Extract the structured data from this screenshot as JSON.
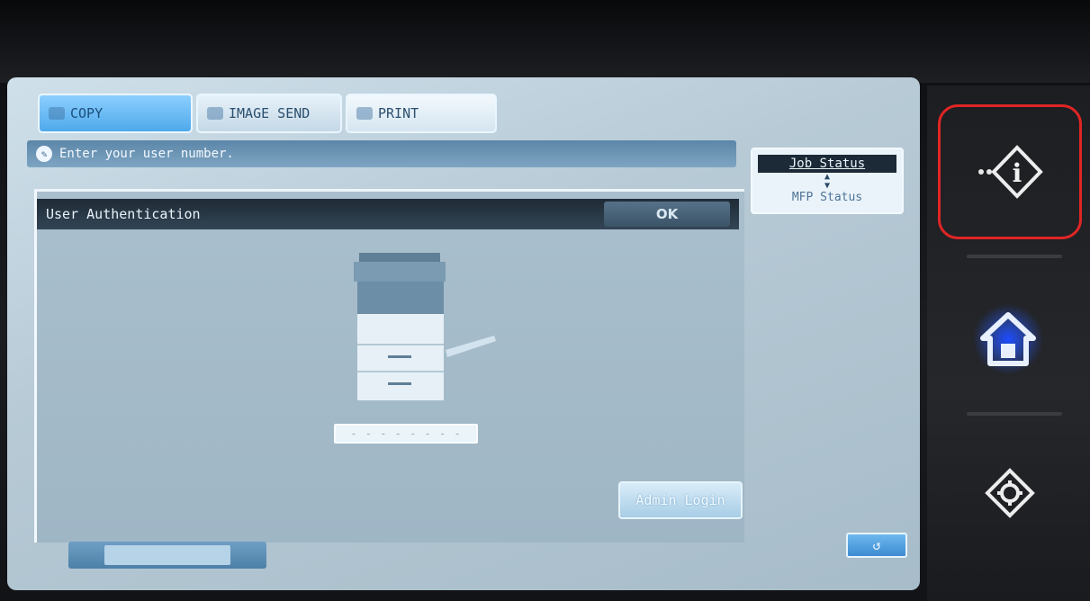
{
  "tabs": {
    "copy": "COPY",
    "image_send": "IMAGE SEND",
    "print": "PRINT"
  },
  "message": "Enter your user number.",
  "auth": {
    "title": "User Authentication",
    "ok": "OK",
    "user_number_placeholder": "- - - - - - - -",
    "admin_login": "Admin Login"
  },
  "status_panel": {
    "job_status": "Job Status",
    "toggle_arrows": "▲\n▼",
    "mfp_status": "MFP Status"
  },
  "hardware": {
    "info_icon": "info-icon",
    "home_icon": "home-icon",
    "settings_icon": "settings-icon",
    "highlight_color": "#e02525",
    "home_glow_color": "#2a63ff"
  },
  "colors": {
    "screen_bg": "#b7cad6",
    "tab_active": "#4fa9ea",
    "header_dark": "#1f2b36"
  }
}
